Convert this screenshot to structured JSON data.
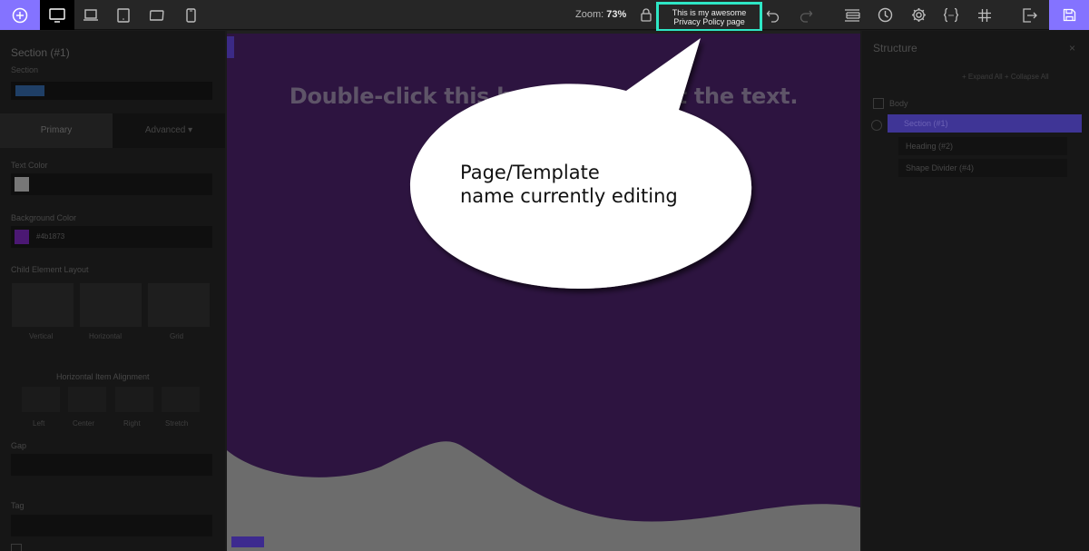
{
  "toolbar": {
    "zoom_label": "Zoom:",
    "zoom_value": "73%",
    "page_name": "This is my awesome Privacy Policy page",
    "icons": {
      "add": "plus-circle-icon",
      "desktop": "desktop-icon",
      "laptop": "laptop-icon",
      "tablet_landscape": "tablet-landscape-icon",
      "tablet_portrait": "tablet-portrait-icon",
      "mobile": "mobile-icon",
      "lock": "lock-icon",
      "undo": "undo-icon",
      "redo": "redo-icon",
      "panels": "panels-icon",
      "history": "clock-icon",
      "settings": "gear-icon",
      "code": "braces-icon",
      "grid": "hash-icon",
      "exit": "exit-icon",
      "save": "save-icon"
    },
    "colors": {
      "accent": "#8473ff",
      "highlight": "#2ee6c5"
    }
  },
  "left_panel": {
    "title": "Section (#1)",
    "subtitle": "Section",
    "tabs": [
      "Primary",
      "Advanced ▾"
    ],
    "labels": {
      "text_color": "Text Color",
      "background_color": "Background Color",
      "background_value": "#4b1873",
      "child_layout": "Child Element Layout",
      "h_align": "Horizontal Item Alignment",
      "gap": "Gap",
      "tag": "Tag"
    },
    "layouts": [
      "Vertical",
      "Horizontal",
      "Grid"
    ],
    "alignments": [
      "Left",
      "Center",
      "Right",
      "Stretch"
    ]
  },
  "canvas": {
    "heading": "Double-click this headline to edit the text.",
    "background": "#2d1440"
  },
  "right_panel": {
    "title": "Structure",
    "close": "×",
    "expand_collapse": "+ Expand All   + Collapse All",
    "tree": {
      "body": "Body",
      "section": "Section (#1)",
      "heading": "Heading (#2)",
      "shape_divider": "Shape Divider (#4)"
    }
  },
  "callout": {
    "text_line1": "Page/Template",
    "text_line2": "name currently editing"
  }
}
